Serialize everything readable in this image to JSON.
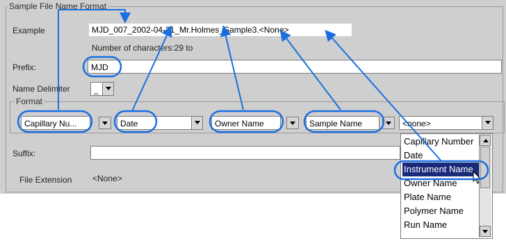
{
  "group": {
    "title": "Sample File Name Format"
  },
  "example": {
    "label": "Example",
    "value": "MJD_007_2002-04-21_Mr.Holmes_Sample3.<None>",
    "char_count": "Number of characters:29 to"
  },
  "prefix": {
    "label": "Prefix:",
    "value": "MJD"
  },
  "name_delimiter": {
    "label": "Name Delimiter",
    "value": "_"
  },
  "format": {
    "title": "Format",
    "fields": [
      "Capillary Nu...",
      "Date",
      "Owner Name",
      "Sample Name",
      "<none>"
    ]
  },
  "suffix": {
    "label": "Suffix:",
    "value": ""
  },
  "file_extension": {
    "label": "File Extension",
    "value": "<None>"
  },
  "dropdown": {
    "items": [
      "Capillary Number",
      "Date",
      "Instrument Name",
      "Owner Name",
      "Plate Name",
      "Polymer Name",
      "Run Name"
    ],
    "selected": "Instrument Name"
  },
  "colors": {
    "callout": "#1a6fe0",
    "selection": "#1a2a7a",
    "panel": "#cfcfcf"
  }
}
